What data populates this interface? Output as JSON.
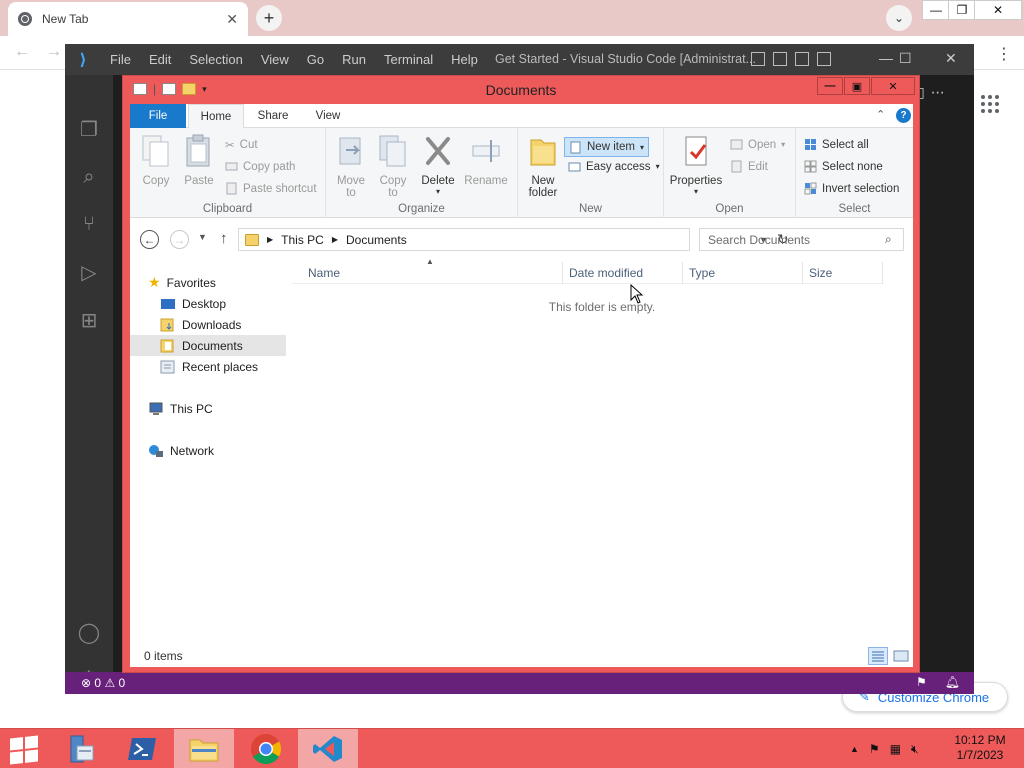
{
  "chrome": {
    "tab_title": "New Tab",
    "customize_label": "Customize Chrome"
  },
  "vscode": {
    "menu": [
      "File",
      "Edit",
      "Selection",
      "View",
      "Go",
      "Run",
      "Terminal",
      "Help"
    ],
    "window_title": "Get Started - Visual Studio Code [Administrat...",
    "status_errors": "0",
    "status_warnings": "0"
  },
  "explorer": {
    "title": "Documents",
    "ribbon_tabs": {
      "file": "File",
      "home": "Home",
      "share": "Share",
      "view": "View"
    },
    "clipboard": {
      "copy": "Copy",
      "paste": "Paste",
      "cut": "Cut",
      "copy_path": "Copy path",
      "paste_shortcut": "Paste shortcut",
      "label": "Clipboard"
    },
    "organize": {
      "move_to_1": "Move",
      "move_to_2": "to",
      "copy_to_1": "Copy",
      "copy_to_2": "to",
      "delete": "Delete",
      "rename": "Rename",
      "label": "Organize"
    },
    "new": {
      "new_folder_1": "New",
      "new_folder_2": "folder",
      "new_item": "New item",
      "easy_access": "Easy access",
      "label": "New"
    },
    "open": {
      "properties": "Properties",
      "open": "Open",
      "edit": "Edit",
      "label": "Open"
    },
    "select": {
      "select_all": "Select all",
      "select_none": "Select none",
      "invert": "Invert selection",
      "label": "Select"
    },
    "address": {
      "crumb1": "This PC",
      "crumb2": "Documents"
    },
    "search_placeholder": "Search Documents",
    "nav": {
      "favorites": "Favorites",
      "desktop": "Desktop",
      "downloads": "Downloads",
      "documents": "Documents",
      "recent": "Recent places",
      "this_pc": "This PC",
      "network": "Network"
    },
    "columns": {
      "name": "Name",
      "date": "Date modified",
      "type": "Type",
      "size": "Size"
    },
    "empty_message": "This folder is empty.",
    "status": "0 items"
  },
  "taskbar": {
    "time": "10:12 PM",
    "date": "1/7/2023"
  },
  "colors": {
    "explorer_frame": "#ee5a5a",
    "vscode_status": "#68217a",
    "ribbon_file_tab": "#1979ca"
  }
}
